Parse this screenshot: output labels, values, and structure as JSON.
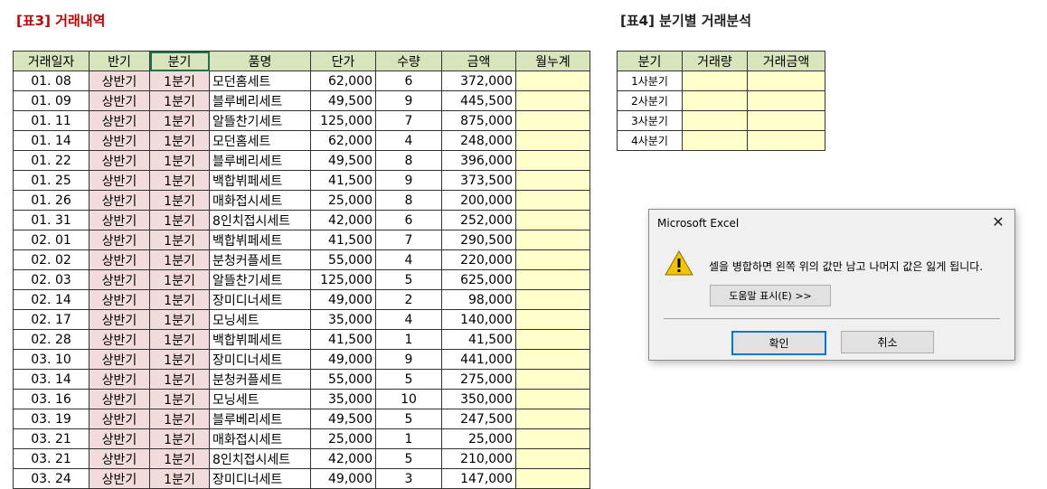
{
  "title3": "[표3] 거래내역",
  "title4": "[표4] 분기별 거래분석",
  "table3": {
    "headers": [
      "거래일자",
      "반기",
      "분기",
      "품명",
      "단가",
      "수량",
      "금액",
      "월누계"
    ],
    "rows": [
      [
        "01. 08",
        "상반기",
        "1분기",
        "모던홈세트",
        "62,000",
        "6",
        "372,000",
        ""
      ],
      [
        "01. 09",
        "상반기",
        "1분기",
        "블루베리세트",
        "49,500",
        "9",
        "445,500",
        ""
      ],
      [
        "01. 11",
        "상반기",
        "1분기",
        "알뜰찬기세트",
        "125,000",
        "7",
        "875,000",
        ""
      ],
      [
        "01. 14",
        "상반기",
        "1분기",
        "모던홈세트",
        "62,000",
        "4",
        "248,000",
        ""
      ],
      [
        "01. 22",
        "상반기",
        "1분기",
        "블루베리세트",
        "49,500",
        "8",
        "396,000",
        ""
      ],
      [
        "01. 25",
        "상반기",
        "1분기",
        "백합뷔페세트",
        "41,500",
        "9",
        "373,500",
        ""
      ],
      [
        "01. 26",
        "상반기",
        "1분기",
        "매화접시세트",
        "25,000",
        "8",
        "200,000",
        ""
      ],
      [
        "01. 31",
        "상반기",
        "1분기",
        "8인치접시세트",
        "42,000",
        "6",
        "252,000",
        ""
      ],
      [
        "02. 01",
        "상반기",
        "1분기",
        "백합뷔페세트",
        "41,500",
        "7",
        "290,500",
        ""
      ],
      [
        "02. 02",
        "상반기",
        "1분기",
        "분청커플세트",
        "55,000",
        "4",
        "220,000",
        ""
      ],
      [
        "02. 03",
        "상반기",
        "1분기",
        "알뜰찬기세트",
        "125,000",
        "5",
        "625,000",
        ""
      ],
      [
        "02. 14",
        "상반기",
        "1분기",
        "장미디너세트",
        "49,000",
        "2",
        "98,000",
        ""
      ],
      [
        "02. 17",
        "상반기",
        "1분기",
        "모닝세트",
        "35,000",
        "4",
        "140,000",
        ""
      ],
      [
        "02. 28",
        "상반기",
        "1분기",
        "백합뷔페세트",
        "41,500",
        "1",
        "41,500",
        ""
      ],
      [
        "03. 10",
        "상반기",
        "1분기",
        "장미디너세트",
        "49,000",
        "9",
        "441,000",
        ""
      ],
      [
        "03. 14",
        "상반기",
        "1분기",
        "분청커플세트",
        "55,000",
        "5",
        "275,000",
        ""
      ],
      [
        "03. 16",
        "상반기",
        "1분기",
        "모닝세트",
        "35,000",
        "10",
        "350,000",
        ""
      ],
      [
        "03. 19",
        "상반기",
        "1분기",
        "블루베리세트",
        "49,500",
        "5",
        "247,500",
        ""
      ],
      [
        "03. 21",
        "상반기",
        "1분기",
        "매화접시세트",
        "25,000",
        "1",
        "25,000",
        ""
      ],
      [
        "03. 21",
        "상반기",
        "1분기",
        "8인치접시세트",
        "42,000",
        "5",
        "210,000",
        ""
      ],
      [
        "03. 24",
        "상반기",
        "1분기",
        "장미디너세트",
        "49,000",
        "3",
        "147,000",
        ""
      ]
    ]
  },
  "table4": {
    "headers": [
      "분기",
      "거래량",
      "거래금액"
    ],
    "rows": [
      [
        "1사분기",
        "",
        ""
      ],
      [
        "2사분기",
        "",
        ""
      ],
      [
        "3사분기",
        "",
        ""
      ],
      [
        "4사분기",
        "",
        ""
      ]
    ]
  },
  "dialog": {
    "title": "Microsoft Excel",
    "message": "셀을 병합하면 왼쪽 위의 값만 남고 나머지 값은 잃게 됩니다.",
    "help_button": "도움말 표시(E) >>",
    "ok_button": "확인",
    "cancel_button": "취소",
    "icon": "warning-icon"
  },
  "colors": {
    "header_green": "#d8e4bc",
    "pink_fill": "#f2dcdb",
    "yellow_fill": "#ffffcc",
    "title_red": "#c00000",
    "focus_blue": "#0078d7"
  }
}
